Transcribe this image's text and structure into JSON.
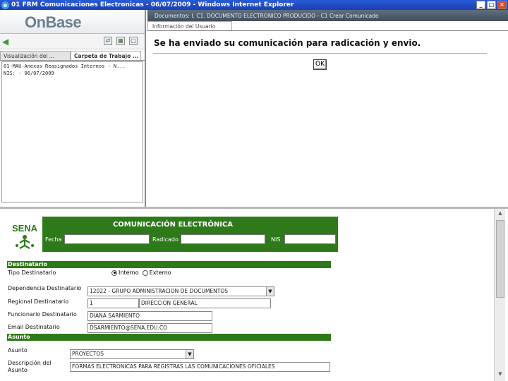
{
  "window": {
    "title": "01 FRM Comunicaciones Electronicas - 06/07/2009 - Windows Internet Explorer",
    "buttons": [
      "_",
      "□",
      "×"
    ]
  },
  "left_panel": {
    "logo": "OnBase",
    "tabs": [
      "Visualización del ...",
      "Carpeta de Trabajo ..."
    ],
    "list_lines": [
      "01-MAU-Anexos Reasignados Internos - N...",
      "NIS: - 06/07/2009"
    ]
  },
  "right_panel": {
    "doc_bar": "Documentos: I. C1. DOCUMENTO ELECTRONICO PRODUCIDO - C1 Crear Comunicado",
    "tab": "Información del Usuario",
    "message": "Se ha enviado su comunicación para radicación y envio.",
    "ok_label": "OK"
  },
  "form": {
    "logo_text": "SENA",
    "header_title": "COMUNICACIÓN ELECTRÓNICA",
    "header_fields": {
      "fecha": "Fecha",
      "radicado": "Radicado",
      "nis": "NIS"
    },
    "sections": {
      "destinatario": "Destinatario",
      "asunto": "Asunto"
    },
    "labels": {
      "tipo": "Tipo Destinatario",
      "dependencia": "Dependencia Destinatario",
      "regional": "Regional Destinatario",
      "funcionario": "Funcionario Destinatario",
      "email": "Email Destinatario",
      "asunto": "Asunto",
      "descripcion": "Descripción del Asunto"
    },
    "tipo_options": {
      "interno": "Interno",
      "externo": "Externo",
      "selected": "interno"
    },
    "values": {
      "dependencia": "12022 - GRUPO ADMINISTRACION DE DOCUMENTOS",
      "regional_code": "1",
      "regional_name": "DIRECCION GENERAL",
      "funcionario": "DIANA SARMIENTO",
      "email": "DSARMIENTO@SENA.EDU.CO",
      "asunto": "PROYECTOS",
      "descripcion": "FORMAS ELECTRONICAS PARA REGISTRAS LAS COMUNICACIONES OFICIALES"
    }
  },
  "colors": {
    "form_green": "#2e7a1a",
    "title_blue": "#2a5bd7"
  }
}
